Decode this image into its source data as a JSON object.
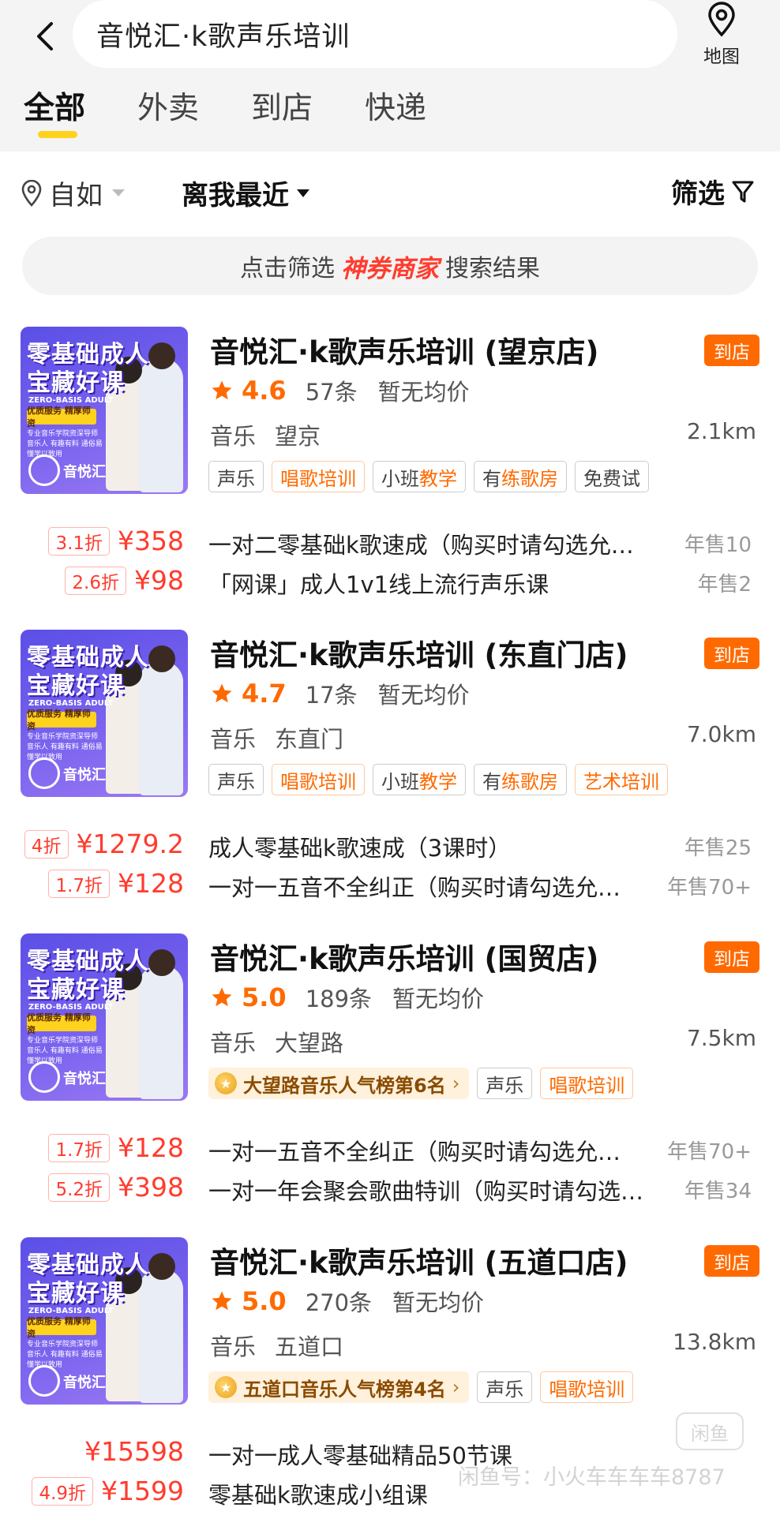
{
  "search": {
    "query": "音悦汇·k歌声乐培训"
  },
  "header": {
    "map_label": "地图"
  },
  "tabs": [
    {
      "label": "全部",
      "active": true
    },
    {
      "label": "外卖",
      "active": false
    },
    {
      "label": "到店",
      "active": false
    },
    {
      "label": "快递",
      "active": false
    }
  ],
  "filters": {
    "location": "自如",
    "sort": "离我最近",
    "screen": "筛选"
  },
  "banner": {
    "prefix": "点击筛选",
    "brand": "神券商家",
    "suffix": "搜索结果"
  },
  "thumbnail": {
    "title_line1": "零基础成人",
    "title_line2": "宝藏好课",
    "subtitle": "ZERO-BASIS ADULT",
    "tag": "优质服务 精厚师资",
    "desc": "专业音乐学院资深导师 音乐人 有趣有料 通俗易懂学以致用",
    "logo_text": "音悦汇"
  },
  "shops": [
    {
      "name": "音悦汇·k歌声乐培训 (望京店)",
      "badge": "到店",
      "rating": "4.6",
      "reviews": "57条",
      "avg_price": "暂无均价",
      "category": "音乐",
      "area": "望京",
      "distance": "2.1km",
      "rank": "",
      "tags": [
        {
          "pre": "",
          "hl": "",
          "text": "声乐",
          "orange": false
        },
        {
          "pre": "",
          "hl": "",
          "text": "唱歌培训",
          "orange": true
        },
        {
          "pre": "小班",
          "hl": "教学",
          "text": "",
          "orange": false
        },
        {
          "pre": "有",
          "hl": "练歌房",
          "text": "",
          "orange": false
        },
        {
          "pre": "",
          "hl": "",
          "text": "免费试",
          "orange": false
        }
      ],
      "deals": [
        {
          "discount": "3.1折",
          "price": "¥358",
          "title": "一对二零基础k歌速成（购买时请勾选允…",
          "sales": "年售10"
        },
        {
          "discount": "2.6折",
          "price": "¥98",
          "title": "「网课」成人1v1线上流行声乐课",
          "sales": "年售2"
        }
      ]
    },
    {
      "name": "音悦汇·k歌声乐培训 (东直门店)",
      "badge": "到店",
      "rating": "4.7",
      "reviews": "17条",
      "avg_price": "暂无均价",
      "category": "音乐",
      "area": "东直门",
      "distance": "7.0km",
      "rank": "",
      "tags": [
        {
          "pre": "",
          "hl": "",
          "text": "声乐",
          "orange": false
        },
        {
          "pre": "",
          "hl": "",
          "text": "唱歌培训",
          "orange": true
        },
        {
          "pre": "小班",
          "hl": "教学",
          "text": "",
          "orange": false
        },
        {
          "pre": "有",
          "hl": "练歌房",
          "text": "",
          "orange": false
        },
        {
          "pre": "",
          "hl": "",
          "text": "艺术培训",
          "orange": true
        }
      ],
      "deals": [
        {
          "discount": "4折",
          "price": "¥1279.2",
          "title": "成人零基础k歌速成（3课时）",
          "sales": "年售25"
        },
        {
          "discount": "1.7折",
          "price": "¥128",
          "title": "一对一五音不全纠正（购买时请勾选允…",
          "sales": "年售70+"
        }
      ]
    },
    {
      "name": "音悦汇·k歌声乐培训 (国贸店)",
      "badge": "到店",
      "rating": "5.0",
      "reviews": "189条",
      "avg_price": "暂无均价",
      "category": "音乐",
      "area": "大望路",
      "distance": "7.5km",
      "rank": "大望路音乐人气榜第6名",
      "tags": [
        {
          "pre": "",
          "hl": "",
          "text": "声乐",
          "orange": false
        },
        {
          "pre": "",
          "hl": "",
          "text": "唱歌培训",
          "orange": true
        }
      ],
      "deals": [
        {
          "discount": "1.7折",
          "price": "¥128",
          "title": "一对一五音不全纠正（购买时请勾选允…",
          "sales": "年售70+"
        },
        {
          "discount": "5.2折",
          "price": "¥398",
          "title": "一对一年会聚会歌曲特训（购买时请勾选…",
          "sales": "年售34"
        }
      ]
    },
    {
      "name": "音悦汇·k歌声乐培训 (五道口店)",
      "badge": "到店",
      "rating": "5.0",
      "reviews": "270条",
      "avg_price": "暂无均价",
      "category": "音乐",
      "area": "五道口",
      "distance": "13.8km",
      "rank": "五道口音乐人气榜第4名",
      "tags": [
        {
          "pre": "",
          "hl": "",
          "text": "声乐",
          "orange": false
        },
        {
          "pre": "",
          "hl": "",
          "text": "唱歌培训",
          "orange": true
        }
      ],
      "deals": [
        {
          "discount": "",
          "price": "¥15598",
          "title": "一对一成人零基础精品50节课",
          "sales": ""
        },
        {
          "discount": "4.9折",
          "price": "¥1599",
          "title": "零基础k歌速成小组课",
          "sales": ""
        }
      ]
    }
  ],
  "watermark": {
    "text": "闲鱼号：小火车车车车8787",
    "logo": "闲鱼"
  },
  "colors": {
    "accent": "#ff6a00",
    "price": "#ff3c2e",
    "tab_underline": "#ffd21e"
  }
}
